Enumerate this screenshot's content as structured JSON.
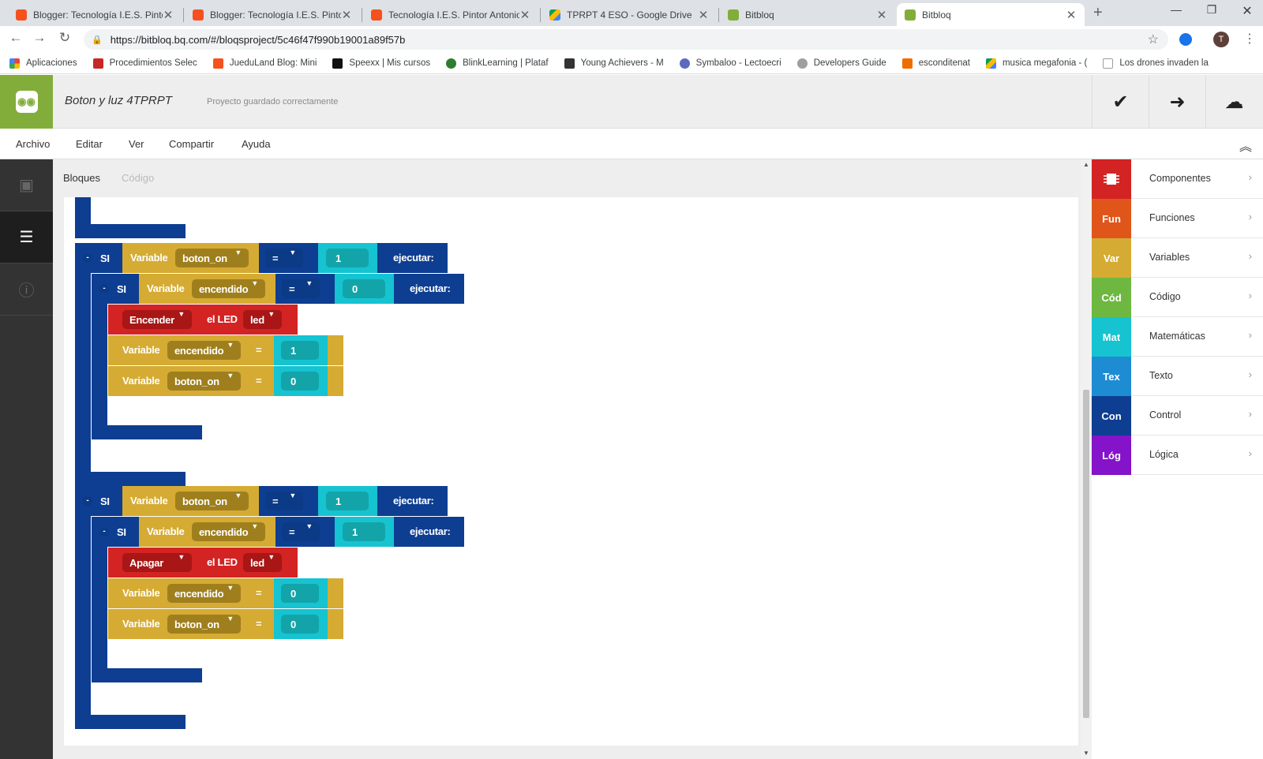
{
  "browser": {
    "tabs": [
      {
        "title": "Blogger: Tecnología I.E.S. Pintor A",
        "icon": "blogger-icon",
        "active": false
      },
      {
        "title": "Blogger: Tecnología I.E.S. Pintor A",
        "icon": "blogger-icon",
        "active": false
      },
      {
        "title": "Tecnología I.E.S. Pintor Antonio L",
        "icon": "blogger-icon",
        "active": false
      },
      {
        "title": "TPRPT 4 ESO - Google Drive",
        "icon": "drive-icon",
        "active": false
      },
      {
        "title": "Bitbloq",
        "icon": "bitbloq-icon",
        "active": false
      },
      {
        "title": "Bitbloq",
        "icon": "bitbloq-icon",
        "active": true
      }
    ],
    "url": "https://bitbloq.bq.com/#/bloqsproject/5c46f47f990b19001a89f57b",
    "avatar_letter": "T",
    "bookmarks": [
      {
        "label": "Aplicaciones",
        "color": "#4285f4"
      },
      {
        "label": "Procedimientos Selec",
        "color": "#c62828"
      },
      {
        "label": "JueduLand Blog: Mini",
        "color": "#f4511e"
      },
      {
        "label": "Speexx | Mis cursos",
        "color": "#111111"
      },
      {
        "label": "BlinkLearning | Plataf",
        "color": "#2e7d32"
      },
      {
        "label": "Young Achievers - M",
        "color": "#333333"
      },
      {
        "label": "Symbaloo - Lectoecri",
        "color": "#5c6bc0"
      },
      {
        "label": "Developers Guide",
        "color": "#777777"
      },
      {
        "label": "esconditenat",
        "color": "#ef6c00"
      },
      {
        "label": "musica megafonia - (",
        "color": "#1e88e5"
      },
      {
        "label": "Los drones invaden la",
        "color": "#9e9e9e"
      }
    ]
  },
  "app": {
    "project_name": "Boton y luz 4TPRPT",
    "save_status": "Proyecto guardado correctamente",
    "menu": [
      "Archivo",
      "Editar",
      "Ver",
      "Compartir",
      "Ayuda"
    ],
    "workspace_tabs": [
      "Bloques",
      "Código"
    ],
    "categories": [
      {
        "abbr": "",
        "label": "Componentes",
        "color": "#d32323"
      },
      {
        "abbr": "Fun",
        "label": "Funciones",
        "color": "#e0561a"
      },
      {
        "abbr": "Var",
        "label": "Variables",
        "color": "#d5ab33"
      },
      {
        "abbr": "Cód",
        "label": "Código",
        "color": "#6eb842"
      },
      {
        "abbr": "Mat",
        "label": "Matemáticas",
        "color": "#16c3d1"
      },
      {
        "abbr": "Tex",
        "label": "Texto",
        "color": "#1e8cd3"
      },
      {
        "abbr": "Con",
        "label": "Control",
        "color": "#0e3e91"
      },
      {
        "abbr": "Lóg",
        "label": "Lógica",
        "color": "#8413c9"
      }
    ]
  },
  "blocks": {
    "if_label": "SI",
    "var_label": "Variable",
    "exec_label": "ejecutar:",
    "eq": "=",
    "led_label": "el LED",
    "led_name": "led",
    "group1": {
      "outer_var": "boton_on",
      "outer_val": "1",
      "inner_var": "encendido",
      "inner_val": "0",
      "action": "Encender",
      "set1_var": "encendido",
      "set1_val": "1",
      "set2_var": "boton_on",
      "set2_val": "0"
    },
    "group2": {
      "outer_var": "boton_on",
      "outer_val": "1",
      "inner_var": "encendido",
      "inner_val": "1",
      "action": "Apagar",
      "set1_var": "encendido",
      "set1_val": "0",
      "set2_var": "boton_on",
      "set2_val": "0"
    }
  },
  "colors": {
    "control": "#0e3e91",
    "control_dark": "#0b3a87",
    "variable": "#d5ab33",
    "variable_dark": "#9f7f1d",
    "math": "#16c3d1",
    "math_dark": "#12a4a9",
    "component": "#d32323",
    "component_dark": "#a81616",
    "accent": "#82ad3a"
  }
}
